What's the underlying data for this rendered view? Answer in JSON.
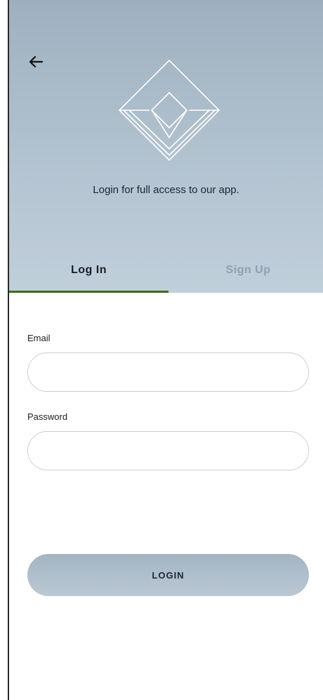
{
  "header": {
    "back_icon": "arrow-left-icon",
    "logo_icon": "diamond-logo-icon",
    "tagline": "Login for full access to our app."
  },
  "tabs": [
    {
      "label": "Log In",
      "active": true
    },
    {
      "label": "Sign Up",
      "active": false
    }
  ],
  "form": {
    "email_label": "Email",
    "email_value": "",
    "password_label": "Password",
    "password_value": "",
    "submit_label": "LOGIN"
  },
  "colors": {
    "header_gradient_top": "#9eb0bf",
    "header_gradient_bottom": "#c0cfda",
    "tab_indicator": "#3b6b1f",
    "inactive_tab": "#8fa1b0"
  }
}
